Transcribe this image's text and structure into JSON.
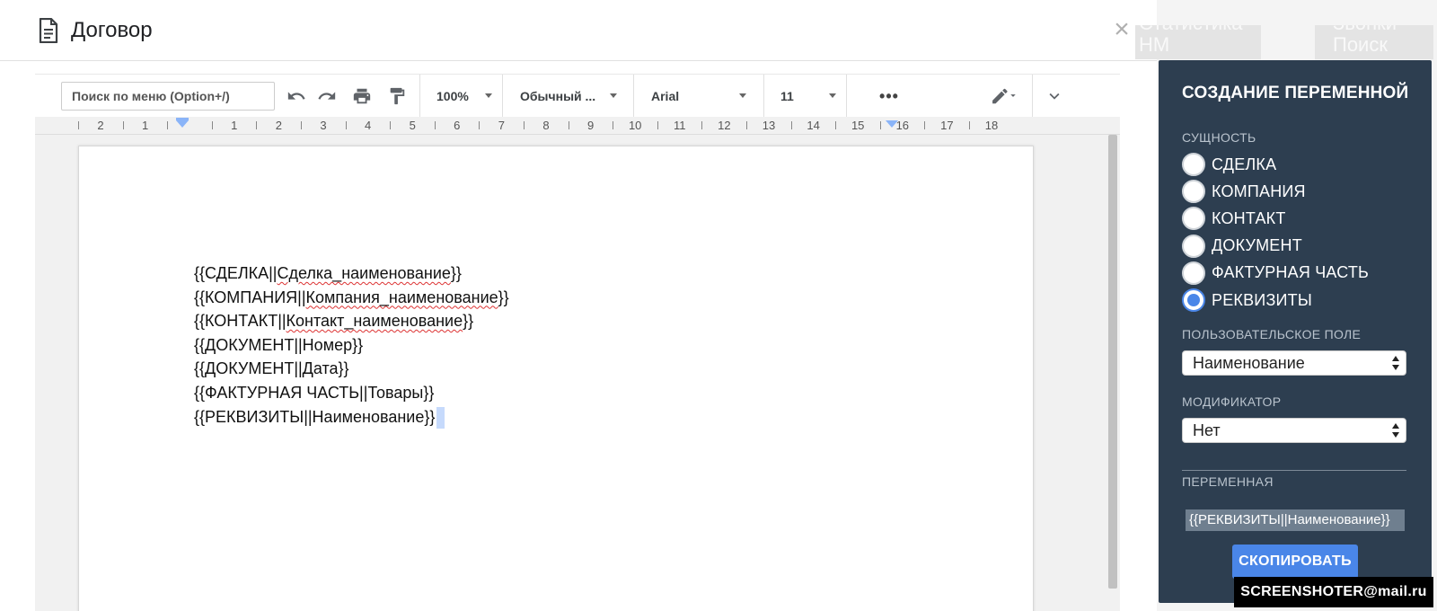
{
  "dialog": {
    "title": "Договор",
    "close_label": "×"
  },
  "toolbar": {
    "search_placeholder": "Поиск по меню (Option+/)",
    "zoom": "100%",
    "style": "Обычный ...",
    "font": "Arial",
    "font_size": "11",
    "more_label": "•••"
  },
  "ruler": {
    "numbers": [
      "2",
      "1",
      "1",
      "2",
      "3",
      "4",
      "5",
      "6",
      "7",
      "8",
      "9",
      "10",
      "11",
      "12",
      "13",
      "14",
      "15",
      "16",
      "17",
      "18"
    ]
  },
  "document": {
    "lines": [
      {
        "prefix": "{{СДЕЛКА||",
        "word": "Сделка_наименование",
        "suffix": "}}"
      },
      {
        "prefix": "{{КОМПАНИЯ||",
        "word": "Компания_наименование",
        "suffix": "}}"
      },
      {
        "prefix": "{{КОНТАКТ||",
        "word": "Контакт_наименование",
        "suffix": "}}"
      },
      {
        "prefix": "{{ДОКУМЕНТ||Номер}}",
        "word": "",
        "suffix": ""
      },
      {
        "prefix": "{{ДОКУМЕНТ||Дата}}",
        "word": "",
        "suffix": ""
      },
      {
        "prefix": "{{ФАКТУРНАЯ ЧАСТЬ||Товары}}",
        "word": "",
        "suffix": ""
      },
      {
        "prefix": "{{РЕКВИЗИТЫ||Наименование}}",
        "word": "",
        "suffix": ""
      }
    ]
  },
  "background": {
    "btn1": "Статистика\nНМ",
    "btn2": "Звонки\nПоиск"
  },
  "panel": {
    "title": "СОЗДАНИЕ ПЕРЕМЕННОЙ",
    "entity_label": "СУЩНОСТЬ",
    "entities": [
      {
        "label": "СДЕЛКА",
        "checked": false
      },
      {
        "label": "КОМПАНИЯ",
        "checked": false
      },
      {
        "label": "КОНТАКТ",
        "checked": false
      },
      {
        "label": "ДОКУМЕНТ",
        "checked": false
      },
      {
        "label": "ФАКТУРНАЯ ЧАСТЬ",
        "checked": false
      },
      {
        "label": "РЕКВИЗИТЫ",
        "checked": true
      }
    ],
    "custom_field_label": "ПОЛЬЗОВАТЕЛЬСКОЕ ПОЛЕ",
    "custom_field_value": "Наименование",
    "modifier_label": "МОДИФИКАТОР",
    "modifier_value": "Нет",
    "variable_label": "ПЕРЕМЕННАЯ",
    "variable_value": "{{РЕКВИЗИТЫ||Наименование}}",
    "copy_button": "СКОПИРОВАТЬ",
    "accent_color": "#4a86e8",
    "bg_color": "#2d3e50"
  },
  "watermark": "SCREENSHOTER@mail.ru"
}
